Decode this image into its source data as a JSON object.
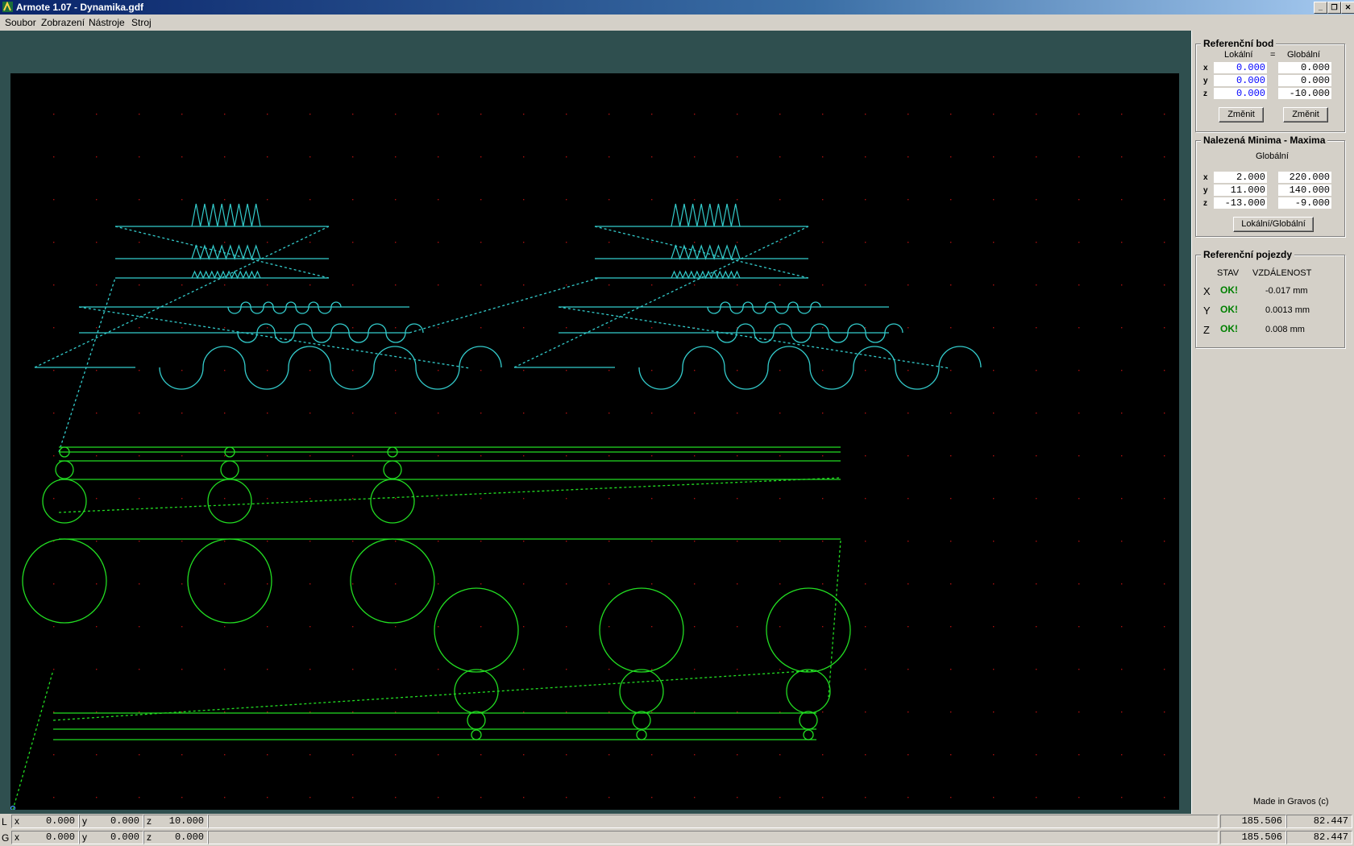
{
  "window": {
    "title": "Armote 1.07 - Dynamika.gdf"
  },
  "menu": [
    "Soubor",
    "Zobrazení",
    "Nástroje",
    "Stroj"
  ],
  "ref_point": {
    "title": "Referenční bod",
    "col_local": "Lokální",
    "col_eq": "=",
    "col_global": "Globální",
    "rows": [
      {
        "axis": "x",
        "local": "0.000",
        "global": "0.000"
      },
      {
        "axis": "y",
        "local": "0.000",
        "global": "0.000"
      },
      {
        "axis": "z",
        "local": "0.000",
        "global": "-10.000"
      }
    ],
    "btn_local": "Změnit",
    "btn_global": "Změnit"
  },
  "minmax": {
    "title": "Nalezená Minima - Maxima",
    "subtitle": "Globální",
    "rows": [
      {
        "axis": "x",
        "min": "2.000",
        "max": "220.000"
      },
      {
        "axis": "y",
        "min": "11.000",
        "max": "140.000"
      },
      {
        "axis": "z",
        "min": "-13.000",
        "max": "-9.000"
      }
    ],
    "toggle_label": "Lokální/Globální"
  },
  "ref_moves": {
    "title": "Referenční pojezdy",
    "col_state": "STAV",
    "col_dist": "VZDÁLENOST",
    "rows": [
      {
        "axis": "X",
        "state": "OK!",
        "dist": "-0.017 mm"
      },
      {
        "axis": "Y",
        "state": "OK!",
        "dist": "0.0013 mm"
      },
      {
        "axis": "Z",
        "state": "OK!",
        "dist": "0.008 mm"
      }
    ]
  },
  "credit": "Made in Gravos (c)",
  "status": {
    "local": {
      "letter": "L",
      "x": "0.000",
      "y": "0.000",
      "z": "10.000",
      "r1": "185.506",
      "r2": "82.447"
    },
    "global": {
      "letter": "G",
      "x": "0.000",
      "y": "0.000",
      "z": "0.000",
      "r1": "185.506",
      "r2": "82.447"
    }
  },
  "colors": {
    "cyan": "#33cccc",
    "green": "#22dd22",
    "grid": "#aa1111",
    "canvas": "#000000",
    "workspace": "#2f4f4f"
  }
}
